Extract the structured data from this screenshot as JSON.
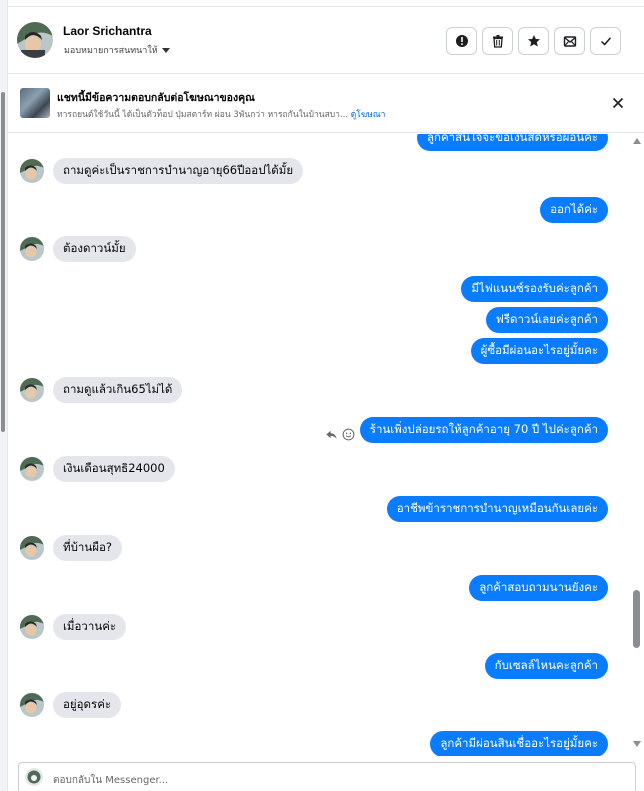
{
  "header": {
    "contact_name": "Laor Srichantra",
    "assign_label": "มอบหมายการสนทนาให้",
    "actions": [
      {
        "icon": "alert-icon",
        "label": "report"
      },
      {
        "icon": "trash-icon",
        "label": "delete"
      },
      {
        "icon": "star-icon",
        "label": "star"
      },
      {
        "icon": "mark-unread-icon",
        "label": "mark-unread"
      },
      {
        "icon": "check-icon",
        "label": "done"
      }
    ]
  },
  "ad_banner": {
    "title": "แชทนี้มีข้อความตอบกลับต่อโฆษณาของคุณ",
    "subtitle": "ทารถยนต์ใช้วันนี้ ได้เป็นตัวท็อป ปุ่มสตาร์ท ผ่อน 3พันกว่า หารถกันในบ้านสบา...",
    "link": "ดูโฆษณา"
  },
  "messages": [
    {
      "dir": "out",
      "text": "ลูกค้าสนใจจะขอเงินสดหรือผ่อนคะ"
    },
    {
      "dir": "in",
      "text": "ถามดูค่ะเป็นราชการบำนาญอายุ66ปีออปได้มั้ย"
    },
    {
      "dir": "out",
      "text": "ออกได้ค่ะ"
    },
    {
      "dir": "in",
      "text": "ต้องดาวน์มั้ย"
    },
    {
      "dir": "out",
      "text": "มีไฟแนนซ์รองรับค่ะลูกค้า"
    },
    {
      "dir": "out",
      "text": "ฟรีดาวน์เลยค่ะลูกค้า"
    },
    {
      "dir": "out",
      "text": "ผู้ซื้อมีผ่อนอะไรอยู่มั้ยคะ"
    },
    {
      "dir": "in",
      "text": "ถามดูแล้วเกิน65ไม่ได้"
    },
    {
      "dir": "out",
      "text": "ร้านเพิ่งปล่อยรถให้ลูกค้าอายุ 70 ปี ไปค่ะลูกค้า"
    },
    {
      "dir": "in",
      "text": "เงินเดือนสุทธิ24000"
    },
    {
      "dir": "out",
      "text": "อาชีพข้าราชการบำนาญเหมือนกันเลยค่ะ"
    },
    {
      "dir": "in",
      "text": "ที่บ้านผือ?"
    },
    {
      "dir": "out",
      "text": "ลูกค้าสอบถามนานยังคะ"
    },
    {
      "dir": "in",
      "text": "เมื่อวานค่ะ"
    },
    {
      "dir": "out",
      "text": "กับเซลล์ไหนคะลูกค้า"
    },
    {
      "dir": "in",
      "text": "อยู่อุดรค่ะ"
    },
    {
      "dir": "out",
      "text": "ลูกค้ามีผ่อนสินเชื่ออะไรอยู่มั้ยคะ"
    }
  ],
  "composer": {
    "placeholder": "ตอบกลับใน Messenger..."
  },
  "colors": {
    "outgoing_bubble": "#0a7cff",
    "incoming_bubble": "#e4e6eb"
  }
}
